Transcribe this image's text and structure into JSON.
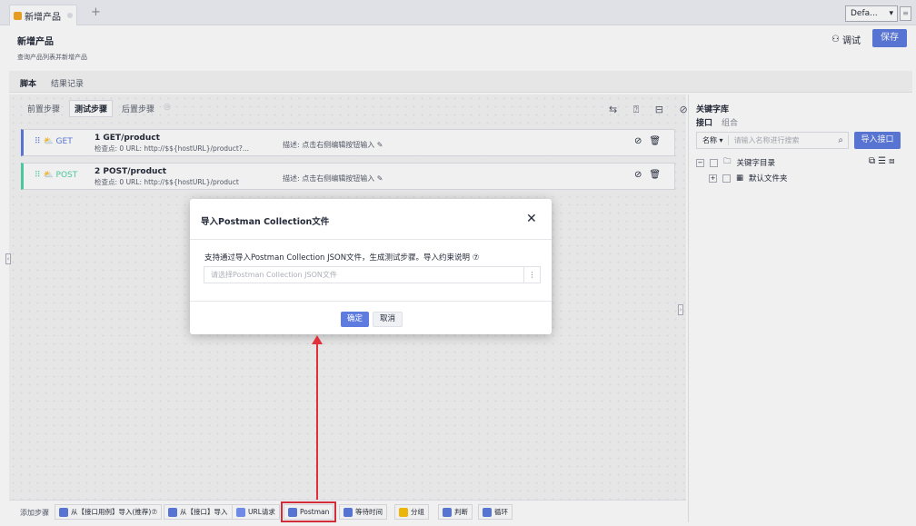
{
  "tabbar": {
    "tab_label": "新增产品",
    "add_symbol": "+",
    "env_value": "Defa...",
    "filter_symbol": "≡"
  },
  "header": {
    "title": "新增产品",
    "subtitle": "查询产品列表并新增产品",
    "debug_label": "调试",
    "save_label": "保存"
  },
  "subtabs": {
    "script": "脚本",
    "results": "结果记录"
  },
  "steps": {
    "tabs": [
      "前置步骤",
      "测试步骤",
      "后置步骤"
    ],
    "toolbar": "⇆ ⍰ ⊟ ⊘ ↺",
    "items": [
      {
        "method": "GET",
        "name": "1  GET/product",
        "info": "检查点:  0   URL:  http://$${hostURL}/product?...",
        "desc": "描述:  点击右侧编辑按钮输入"
      },
      {
        "method": "POST",
        "name": "2  POST/product",
        "info": "检查点:  0   URL:  http://$${hostURL}/product",
        "desc": "描述:  点击右侧编辑按钮输入"
      }
    ]
  },
  "keywords": {
    "title": "关键字库",
    "tab_interface": "接口",
    "tab_combo": "组合",
    "search_field": "名称",
    "search_placeholder": "请输入名称进行搜索",
    "import_button": "导入接口",
    "tree_root": "关键字目录",
    "tree_child": "默认文件夹"
  },
  "bottom": {
    "add_label": "添加步骤",
    "buttons": [
      "从【接口用例】导入(推荐)⑦",
      "从【接口】导入",
      "URL请求",
      "Postman",
      "等待时间",
      "分组",
      "判断",
      "循环"
    ]
  },
  "modal": {
    "title": "导入Postman Collection文件",
    "description": "支持通过导入Postman Collection JSON文件，生成测试步骤。导入约束说明 ⑦",
    "file_placeholder": "请选择Postman Collection JSON文件",
    "ok_label": "确定",
    "cancel_label": "取消"
  },
  "colors": {
    "accent": "#5e7ce0",
    "post": "#50d4ab",
    "highlight": "#e0303c"
  }
}
